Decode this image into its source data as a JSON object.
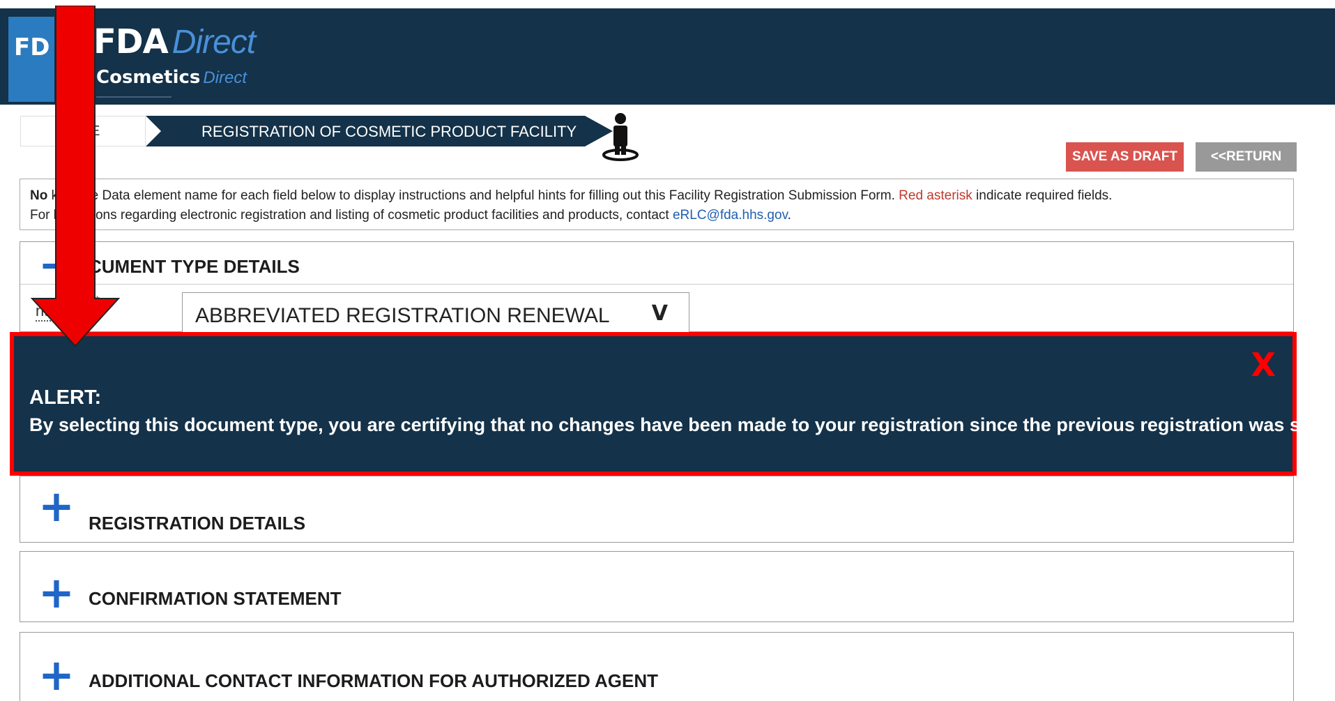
{
  "header": {
    "logo_tile_text": "FD",
    "brand_name": "FDA",
    "brand_name_suffix": "Direct",
    "brand_product": "Cosmetics",
    "brand_product_suffix": "Direct"
  },
  "breadcrumb": {
    "home_label": "E",
    "current_label": "REGISTRATION OF COSMETIC PRODUCT FACILITY"
  },
  "toolbar": {
    "save_draft_label": "SAVE AS DRAFT",
    "return_label": "<<RETURN"
  },
  "note": {
    "line1_prefix": "No",
    "line1_body": "k on the Data element name for each field below to display instructions and helpful hints for filling out this Facility Registration Submission Form.",
    "line1_red": "Red asterisk",
    "line1_suffix": "indicate required fields.",
    "line2_prefix": "For",
    "line2_body": "l questions regarding electronic registration and listing of cosmetic product facilities and products, contact",
    "line2_link": "eRLC@fda.hhs.gov",
    "line2_end": "."
  },
  "sections": {
    "doctype": {
      "title": "CUMENT TYPE DETAILS",
      "field_label": "nt Type:",
      "required_mark": "*",
      "selected_value": "ABBREVIATED REGISTRATION RENEWAL",
      "dropdown_glyph": "V"
    },
    "registration": {
      "title": "REGISTRATION DETAILS",
      "toggle": "+"
    },
    "confirmation": {
      "title": "CONFIRMATION STATEMENT",
      "toggle": "+"
    },
    "agent": {
      "title": "ADDITIONAL CONTACT INFORMATION FOR AUTHORIZED AGENT",
      "toggle": "+"
    }
  },
  "alert": {
    "close_label": "X",
    "title": "ALERT:",
    "message": "By selecting this document type, you are certifying that no changes have been made to your registration since the previous registration was submitted."
  },
  "colors": {
    "header_bg": "#143249",
    "accent_blue": "#1f66c7",
    "alert_border": "#ff0000",
    "save_draft_bg": "#d9534f",
    "return_bg": "#999999"
  },
  "icons": {
    "person": "person-on-ring-icon",
    "annotation_arrow": "red-down-arrow-icon"
  }
}
